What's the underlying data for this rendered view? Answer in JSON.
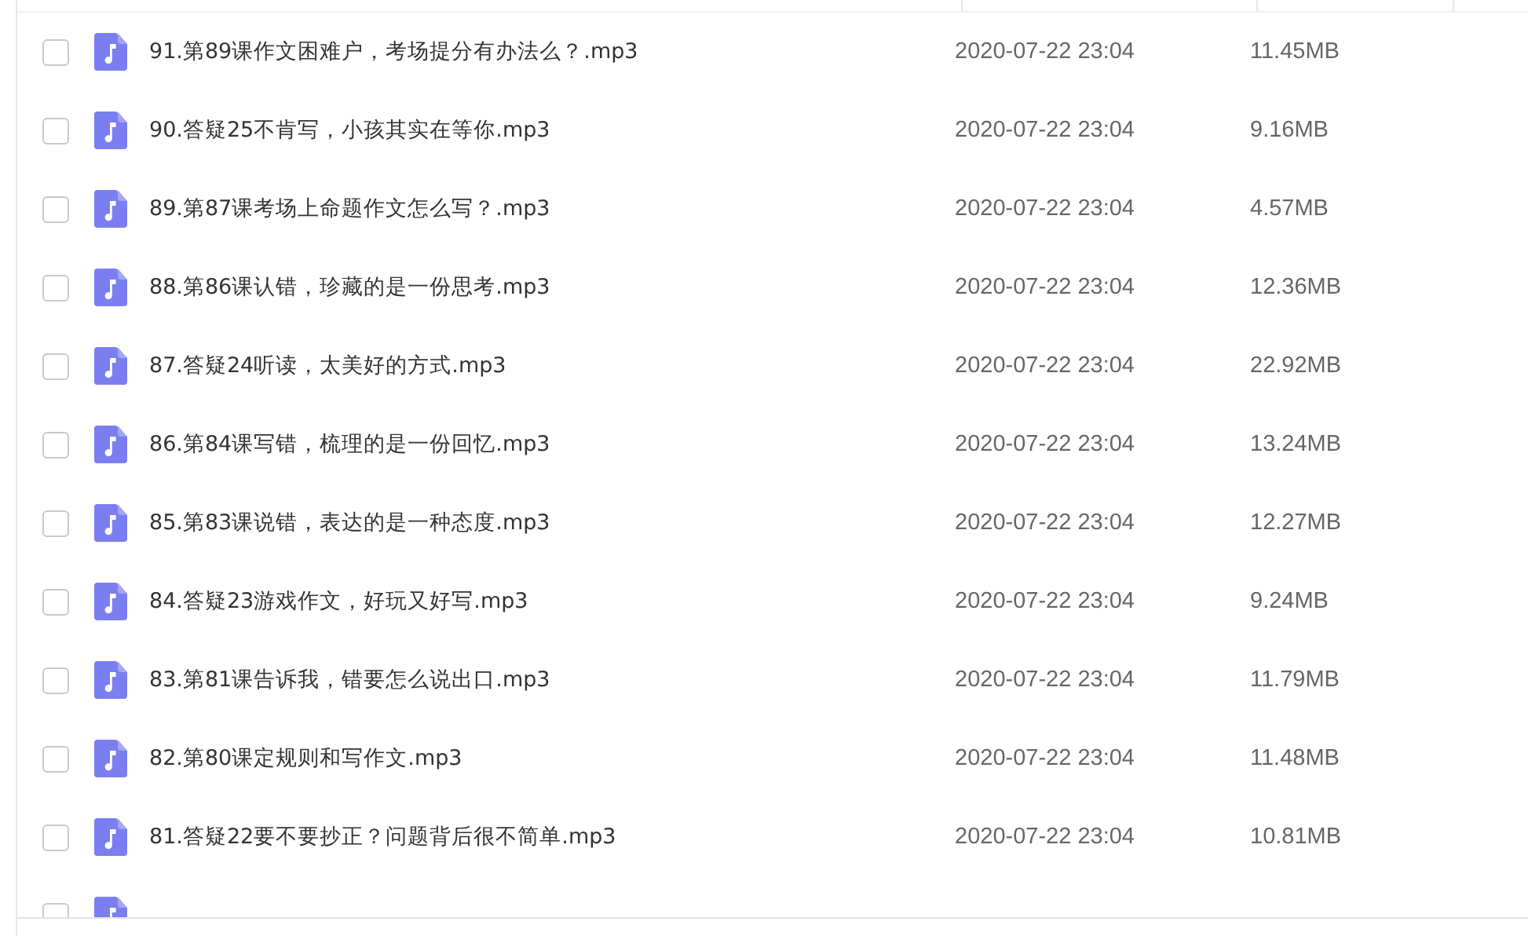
{
  "files": [
    {
      "name": "91.第89课作文困难户，考场提分有办法么？.mp3",
      "modified": "2020-07-22 23:04",
      "size": "11.45MB",
      "checked": false
    },
    {
      "name": "90.答疑25不肯写，小孩其实在等你.mp3",
      "modified": "2020-07-22 23:04",
      "size": "9.16MB",
      "checked": false
    },
    {
      "name": "89.第87课考场上命题作文怎么写？.mp3",
      "modified": "2020-07-22 23:04",
      "size": "4.57MB",
      "checked": false
    },
    {
      "name": "88.第86课认错，珍藏的是一份思考.mp3",
      "modified": "2020-07-22 23:04",
      "size": "12.36MB",
      "checked": false
    },
    {
      "name": "87.答疑24听读，太美好的方式.mp3",
      "modified": "2020-07-22 23:04",
      "size": "22.92MB",
      "checked": false
    },
    {
      "name": "86.第84课写错，梳理的是一份回忆.mp3",
      "modified": "2020-07-22 23:04",
      "size": "13.24MB",
      "checked": false
    },
    {
      "name": "85.第83课说错，表达的是一种态度.mp3",
      "modified": "2020-07-22 23:04",
      "size": "12.27MB",
      "checked": false
    },
    {
      "name": "84.答疑23游戏作文，好玩又好写.mp3",
      "modified": "2020-07-22 23:04",
      "size": "9.24MB",
      "checked": false
    },
    {
      "name": "83.第81课告诉我，错要怎么说出口.mp3",
      "modified": "2020-07-22 23:04",
      "size": "11.79MB",
      "checked": false
    },
    {
      "name": "82.第80课定规则和写作文.mp3",
      "modified": "2020-07-22 23:04",
      "size": "11.48MB",
      "checked": false
    },
    {
      "name": "81.答疑22要不要抄正？问题背后很不简单.mp3",
      "modified": "2020-07-22 23:04",
      "size": "10.81MB",
      "checked": false
    },
    {
      "checked": false
    }
  ]
}
